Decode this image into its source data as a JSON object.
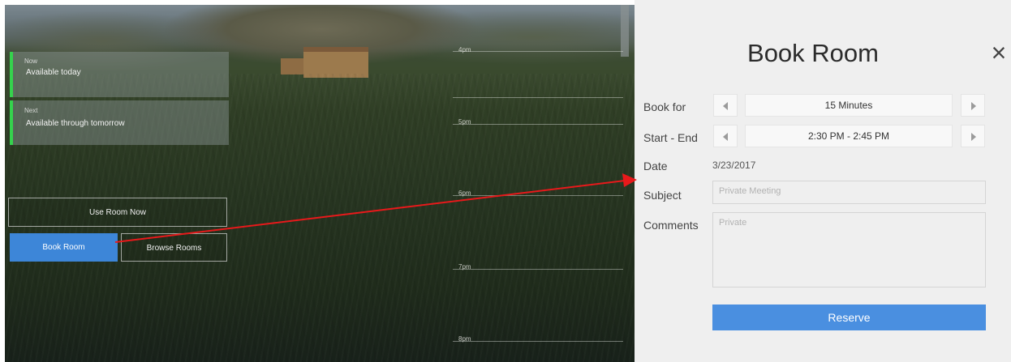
{
  "background": {
    "times": [
      "4pm",
      "5pm",
      "6pm",
      "7pm",
      "8pm"
    ]
  },
  "status": [
    {
      "small": "Now",
      "main": "Available today"
    },
    {
      "small": "Next",
      "main": "Available through tomorrow"
    }
  ],
  "actions": {
    "use_room_now": "Use Room Now",
    "book_room": "Book Room",
    "browse_rooms": "Browse Rooms"
  },
  "panel": {
    "title": "Book Room",
    "close_symbol": "×",
    "book_for_label": "Book for",
    "book_for_value": "15 Minutes",
    "start_end_label": "Start - End",
    "start_end_value": "2:30 PM - 2:45 PM",
    "date_label": "Date",
    "date_value": "3/23/2017",
    "subject_label": "Subject",
    "subject_placeholder": "Private Meeting",
    "comments_label": "Comments",
    "comments_placeholder": "Private",
    "reserve_label": "Reserve"
  },
  "colors": {
    "accent": "#3d86d8",
    "reserve": "#4a8fe0",
    "status_bar": "#35d24d",
    "annotation_arrow": "#e8191b"
  }
}
